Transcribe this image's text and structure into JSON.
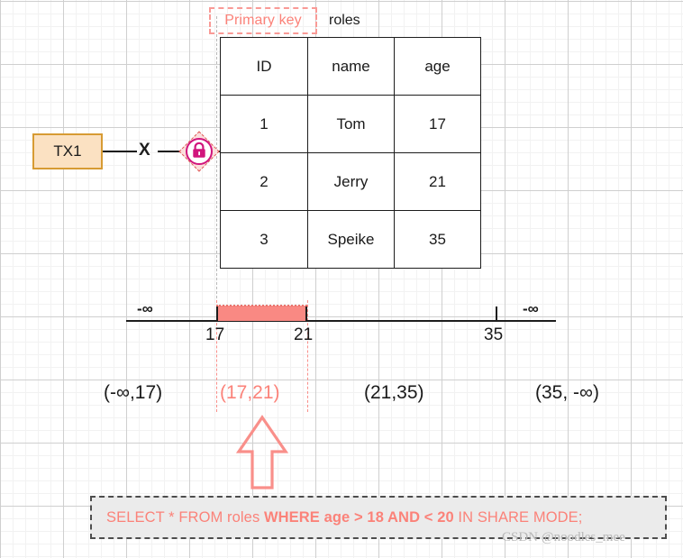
{
  "diagram": {
    "primary_key_callout": "Primary key",
    "table_name": "roles",
    "transaction_box": "TX1",
    "blocked_marker": "X",
    "lock_icon_name": "lock-icon",
    "accent_red": "#fb8279",
    "lock_pink": "#d1157d",
    "tx_fill": "#fbe1c2",
    "tx_border": "#d79b33"
  },
  "table": {
    "headers": [
      "ID",
      "name",
      "age"
    ],
    "rows": [
      [
        "1",
        "Tom",
        "17"
      ],
      [
        "2",
        "Jerry",
        "21"
      ],
      [
        "3",
        "Speike",
        "35"
      ]
    ]
  },
  "number_line": {
    "left_infinity": "-∞",
    "right_infinity": "-∞",
    "ticks": [
      "17",
      "21",
      "35"
    ],
    "highlight_range": "17 to 21"
  },
  "intervals": [
    {
      "label": "(-∞,17)",
      "highlighted": false
    },
    {
      "label": "(17,21)",
      "highlighted": true
    },
    {
      "label": "(21,35)",
      "highlighted": false
    },
    {
      "label": "(35,  -∞)",
      "highlighted": false
    }
  ],
  "sql": {
    "part1": "SELECT * FROM roles ",
    "part2": "WHERE age > 18 AND < 20",
    "part3": "  IN SHARE MODE;"
  },
  "watermark": "CSDN @noodles_mee"
}
